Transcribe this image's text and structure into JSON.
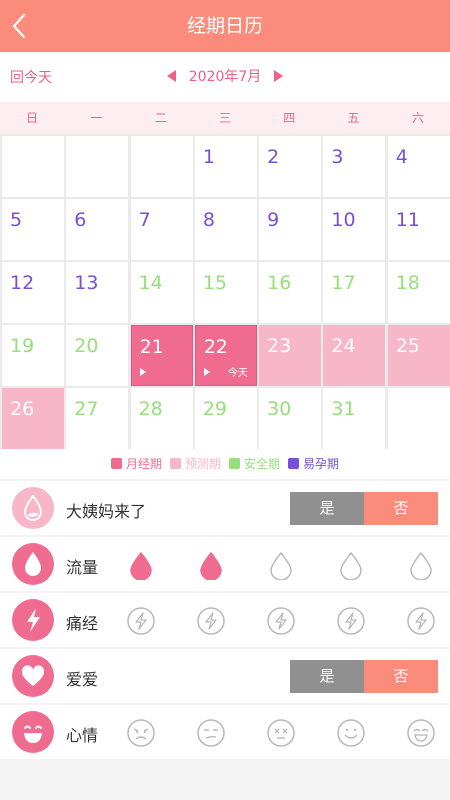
{
  "header": {
    "title": "经期日历"
  },
  "monthbar": {
    "today_label": "回今天",
    "month": "2020年7月"
  },
  "weekdays": [
    "日",
    "一",
    "二",
    "三",
    "四",
    "五",
    "六"
  ],
  "days": [
    {
      "n": "1",
      "type": "fertile"
    },
    {
      "n": "2",
      "type": "fertile"
    },
    {
      "n": "3",
      "type": "fertile"
    },
    {
      "n": "4",
      "type": "fertile"
    },
    {
      "n": "5",
      "type": "fertile"
    },
    {
      "n": "6",
      "type": "fertile"
    },
    {
      "n": "7",
      "type": "fertile"
    },
    {
      "n": "8",
      "type": "fertile"
    },
    {
      "n": "9",
      "type": "fertile"
    },
    {
      "n": "10",
      "type": "fertile"
    },
    {
      "n": "11",
      "type": "fertile"
    },
    {
      "n": "12",
      "type": "fertile"
    },
    {
      "n": "13",
      "type": "fertile"
    },
    {
      "n": "14",
      "type": "safe"
    },
    {
      "n": "15",
      "type": "safe"
    },
    {
      "n": "16",
      "type": "safe"
    },
    {
      "n": "17",
      "type": "safe"
    },
    {
      "n": "18",
      "type": "safe"
    },
    {
      "n": "19",
      "type": "safe"
    },
    {
      "n": "20",
      "type": "safe"
    },
    {
      "n": "21",
      "type": "period",
      "flag": true
    },
    {
      "n": "22",
      "type": "period",
      "flag": true,
      "today": "今天"
    },
    {
      "n": "23",
      "type": "predicted"
    },
    {
      "n": "24",
      "type": "predicted"
    },
    {
      "n": "25",
      "type": "predicted"
    },
    {
      "n": "26",
      "type": "predicted"
    },
    {
      "n": "27",
      "type": "safe"
    },
    {
      "n": "28",
      "type": "safe"
    },
    {
      "n": "29",
      "type": "safe"
    },
    {
      "n": "30",
      "type": "safe"
    },
    {
      "n": "31",
      "type": "safe"
    }
  ],
  "first_weekday": 3,
  "legend": [
    {
      "label": "月经期",
      "color": "#ef6c90"
    },
    {
      "label": "预测期",
      "color": "#f8b7c9"
    },
    {
      "label": "安全期",
      "color": "#96e079"
    },
    {
      "label": "易孕期",
      "color": "#7650d8"
    }
  ],
  "colors": {
    "accent": "#fb8c7b",
    "pink": "#ef6c90",
    "grey_toggle": "#909090",
    "icon_outline": "#b8b8b8"
  },
  "rows": {
    "period_came": {
      "label": "大姨妈来了",
      "yes": "是",
      "no": "否",
      "icon": "drop-percent-icon"
    },
    "flow": {
      "label": "流量",
      "level": 2,
      "max": 5,
      "icon": "drop-icon"
    },
    "cramps": {
      "label": "痛经",
      "icon": "lightning-icon"
    },
    "love": {
      "label": "爱爱",
      "yes": "是",
      "no": "否",
      "icon": "heart-icon"
    },
    "mood": {
      "label": "心情",
      "icon": "smile-icon",
      "options": [
        "angry-face-icon",
        "annoyed-face-icon",
        "dizzy-face-icon",
        "smiling-face-icon",
        "laughing-face-icon"
      ]
    }
  }
}
